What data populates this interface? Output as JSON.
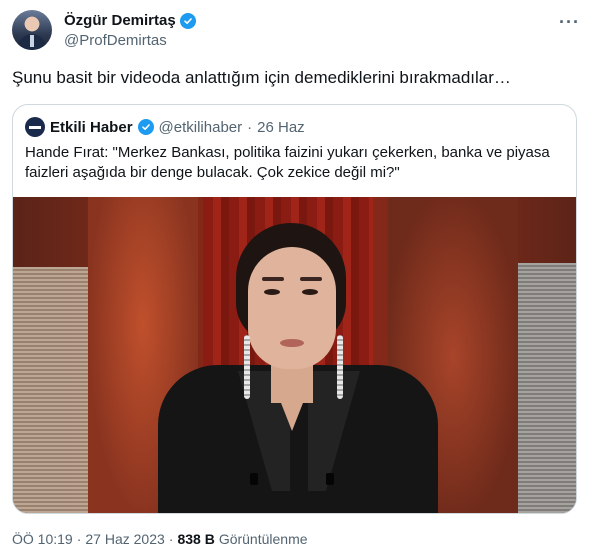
{
  "author": {
    "name": "Özgür Demirtaş",
    "handle": "@ProfDemirtas",
    "verified": true,
    "more_icon": "more-horizontal-icon"
  },
  "tweet": {
    "text": "Şunu basit bir videoda anlattığım için demediklerini bırakmadılar…"
  },
  "quoted": {
    "name": "Etkili Haber",
    "handle": "@etkilihaber",
    "separator": "·",
    "date": "26 Haz",
    "verified": true,
    "text": "Hande Fırat: \"Merkez Bankası, politika faizini yukarı çekerken, banka ve piyasa faizleri aşağıda bir denge bulacak. Çok zekice değil mi?\""
  },
  "meta": {
    "time": "ÖÖ 10:19",
    "separator": "·",
    "date": "27 Haz 2023",
    "separator2": "·",
    "views_count": "838 B",
    "views_label": "Görüntülenme"
  },
  "colors": {
    "verified": "#1d9bf0",
    "text_primary": "#0f1419",
    "text_secondary": "#536471",
    "border": "#cfd9de"
  }
}
